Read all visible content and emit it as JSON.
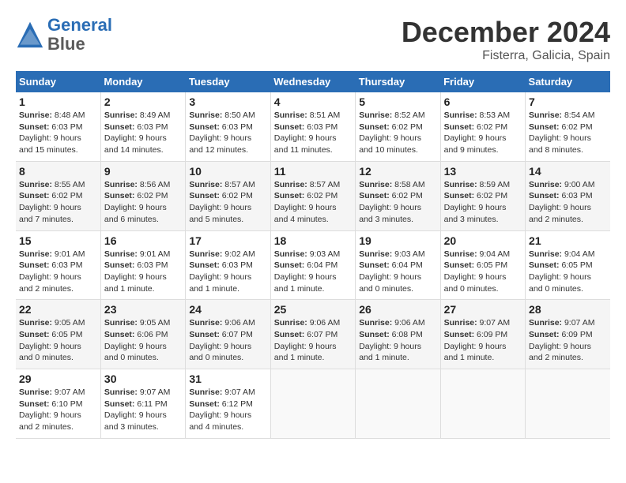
{
  "header": {
    "logo_line1": "General",
    "logo_line2": "Blue",
    "month": "December 2024",
    "location": "Fisterra, Galicia, Spain"
  },
  "days_of_week": [
    "Sunday",
    "Monday",
    "Tuesday",
    "Wednesday",
    "Thursday",
    "Friday",
    "Saturday"
  ],
  "weeks": [
    [
      {
        "day": "1",
        "info": "Sunrise: 8:48 AM\nSunset: 6:03 PM\nDaylight: 9 hours and 15 minutes."
      },
      {
        "day": "2",
        "info": "Sunrise: 8:49 AM\nSunset: 6:03 PM\nDaylight: 9 hours and 14 minutes."
      },
      {
        "day": "3",
        "info": "Sunrise: 8:50 AM\nSunset: 6:03 PM\nDaylight: 9 hours and 12 minutes."
      },
      {
        "day": "4",
        "info": "Sunrise: 8:51 AM\nSunset: 6:03 PM\nDaylight: 9 hours and 11 minutes."
      },
      {
        "day": "5",
        "info": "Sunrise: 8:52 AM\nSunset: 6:02 PM\nDaylight: 9 hours and 10 minutes."
      },
      {
        "day": "6",
        "info": "Sunrise: 8:53 AM\nSunset: 6:02 PM\nDaylight: 9 hours and 9 minutes."
      },
      {
        "day": "7",
        "info": "Sunrise: 8:54 AM\nSunset: 6:02 PM\nDaylight: 9 hours and 8 minutes."
      }
    ],
    [
      {
        "day": "8",
        "info": "Sunrise: 8:55 AM\nSunset: 6:02 PM\nDaylight: 9 hours and 7 minutes."
      },
      {
        "day": "9",
        "info": "Sunrise: 8:56 AM\nSunset: 6:02 PM\nDaylight: 9 hours and 6 minutes."
      },
      {
        "day": "10",
        "info": "Sunrise: 8:57 AM\nSunset: 6:02 PM\nDaylight: 9 hours and 5 minutes."
      },
      {
        "day": "11",
        "info": "Sunrise: 8:57 AM\nSunset: 6:02 PM\nDaylight: 9 hours and 4 minutes."
      },
      {
        "day": "12",
        "info": "Sunrise: 8:58 AM\nSunset: 6:02 PM\nDaylight: 9 hours and 3 minutes."
      },
      {
        "day": "13",
        "info": "Sunrise: 8:59 AM\nSunset: 6:02 PM\nDaylight: 9 hours and 3 minutes."
      },
      {
        "day": "14",
        "info": "Sunrise: 9:00 AM\nSunset: 6:03 PM\nDaylight: 9 hours and 2 minutes."
      }
    ],
    [
      {
        "day": "15",
        "info": "Sunrise: 9:01 AM\nSunset: 6:03 PM\nDaylight: 9 hours and 2 minutes."
      },
      {
        "day": "16",
        "info": "Sunrise: 9:01 AM\nSunset: 6:03 PM\nDaylight: 9 hours and 1 minute."
      },
      {
        "day": "17",
        "info": "Sunrise: 9:02 AM\nSunset: 6:03 PM\nDaylight: 9 hours and 1 minute."
      },
      {
        "day": "18",
        "info": "Sunrise: 9:03 AM\nSunset: 6:04 PM\nDaylight: 9 hours and 1 minute."
      },
      {
        "day": "19",
        "info": "Sunrise: 9:03 AM\nSunset: 6:04 PM\nDaylight: 9 hours and 0 minutes."
      },
      {
        "day": "20",
        "info": "Sunrise: 9:04 AM\nSunset: 6:05 PM\nDaylight: 9 hours and 0 minutes."
      },
      {
        "day": "21",
        "info": "Sunrise: 9:04 AM\nSunset: 6:05 PM\nDaylight: 9 hours and 0 minutes."
      }
    ],
    [
      {
        "day": "22",
        "info": "Sunrise: 9:05 AM\nSunset: 6:05 PM\nDaylight: 9 hours and 0 minutes."
      },
      {
        "day": "23",
        "info": "Sunrise: 9:05 AM\nSunset: 6:06 PM\nDaylight: 9 hours and 0 minutes."
      },
      {
        "day": "24",
        "info": "Sunrise: 9:06 AM\nSunset: 6:07 PM\nDaylight: 9 hours and 0 minutes."
      },
      {
        "day": "25",
        "info": "Sunrise: 9:06 AM\nSunset: 6:07 PM\nDaylight: 9 hours and 1 minute."
      },
      {
        "day": "26",
        "info": "Sunrise: 9:06 AM\nSunset: 6:08 PM\nDaylight: 9 hours and 1 minute."
      },
      {
        "day": "27",
        "info": "Sunrise: 9:07 AM\nSunset: 6:09 PM\nDaylight: 9 hours and 1 minute."
      },
      {
        "day": "28",
        "info": "Sunrise: 9:07 AM\nSunset: 6:09 PM\nDaylight: 9 hours and 2 minutes."
      }
    ],
    [
      {
        "day": "29",
        "info": "Sunrise: 9:07 AM\nSunset: 6:10 PM\nDaylight: 9 hours and 2 minutes."
      },
      {
        "day": "30",
        "info": "Sunrise: 9:07 AM\nSunset: 6:11 PM\nDaylight: 9 hours and 3 minutes."
      },
      {
        "day": "31",
        "info": "Sunrise: 9:07 AM\nSunset: 6:12 PM\nDaylight: 9 hours and 4 minutes."
      },
      {
        "day": "",
        "info": ""
      },
      {
        "day": "",
        "info": ""
      },
      {
        "day": "",
        "info": ""
      },
      {
        "day": "",
        "info": ""
      }
    ]
  ]
}
